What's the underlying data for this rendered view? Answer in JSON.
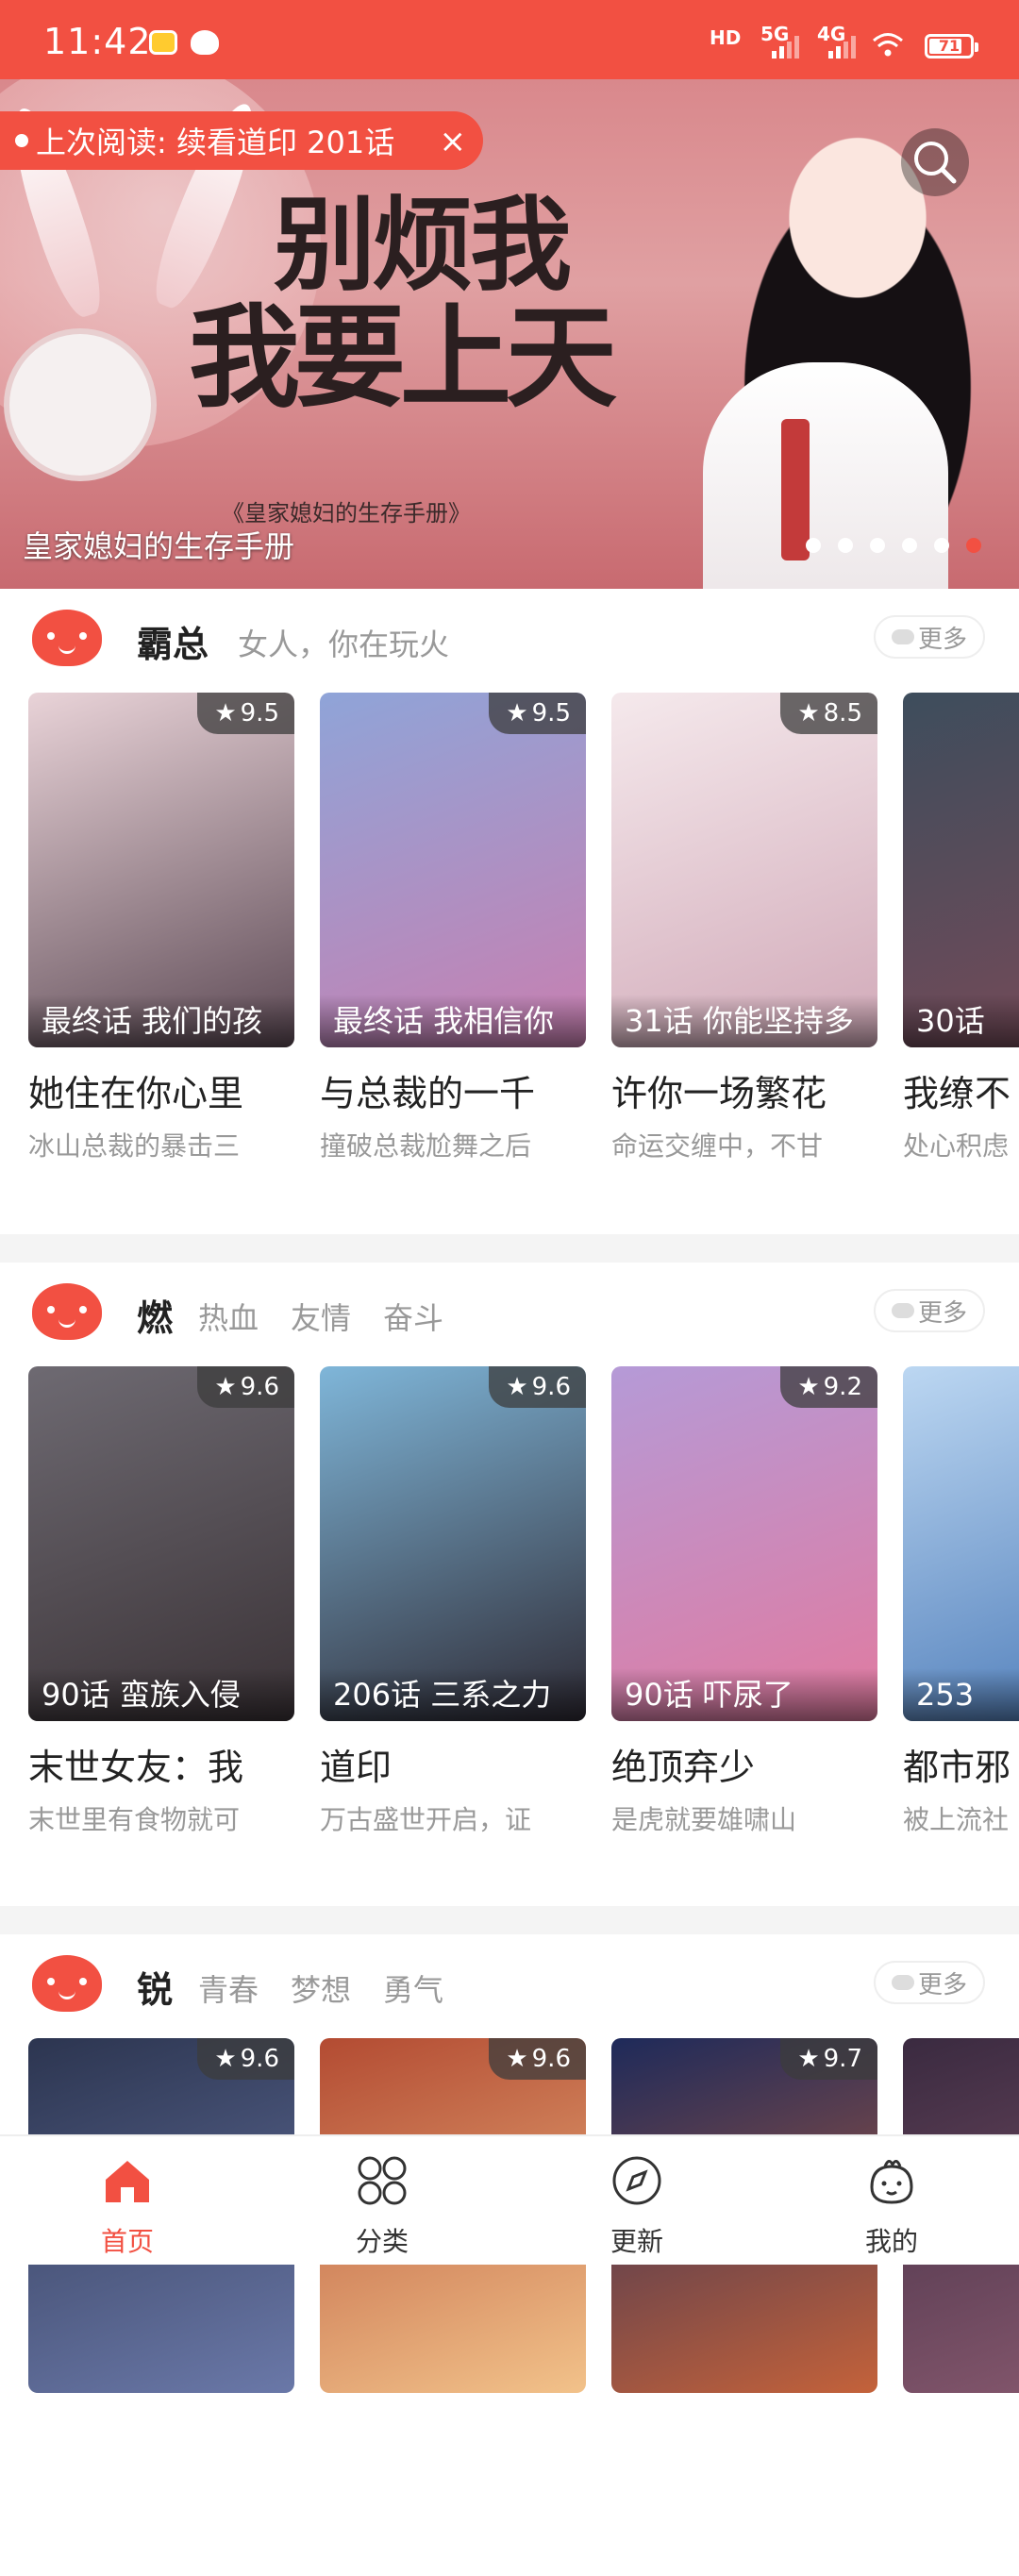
{
  "status_bar": {
    "time": "11:42",
    "network_labels": [
      "HD",
      "5G",
      "4G"
    ],
    "battery": "71"
  },
  "banner": {
    "last_read": "上次阅读: 续看道印 201话",
    "close": "×",
    "art_line1": "别烦我",
    "art_line2": "我要上天",
    "art_subtitle": "《皇家媳妇的生存手册》",
    "caption": "皇家媳妇的生存手册",
    "dot_count": 6,
    "active_dot": 5
  },
  "sections": [
    {
      "title": "霸总",
      "tags": [
        "女人，你在玩火"
      ],
      "more": "更多",
      "cards": [
        {
          "rating": "9.5",
          "episode": "最终话 我们的孩",
          "title": "她住在你心里",
          "desc": "冰山总裁的暴击三",
          "colors": [
            "#e9d3d8",
            "#5d4a55"
          ]
        },
        {
          "rating": "9.5",
          "episode": "最终话 我相信你",
          "title": "与总裁的一千",
          "desc": "撞破总裁尬舞之后",
          "colors": [
            "#8fa4d8",
            "#c87fb0"
          ]
        },
        {
          "rating": "8.5",
          "episode": "31话 你能坚持多",
          "title": "许你一场繁花",
          "desc": "命运交缠中，不甘",
          "colors": [
            "#f5e9ec",
            "#d1a9b8"
          ]
        },
        {
          "rating": "",
          "episode": "30话",
          "title": "我缭不",
          "desc": "处心积虑",
          "colors": [
            "#3d4d5c",
            "#7a4a58"
          ]
        }
      ]
    },
    {
      "title": "燃",
      "tags": [
        "热血",
        "友情",
        "奋斗"
      ],
      "more": "更多",
      "cards": [
        {
          "rating": "9.6",
          "episode": "90话 蛮族入侵",
          "title": "末世女友：我",
          "desc": "末世里有食物就可",
          "colors": [
            "#6e6a72",
            "#3a3236"
          ]
        },
        {
          "rating": "9.6",
          "episode": "206话 三系之力",
          "title": "道印",
          "desc": "万古盛世开启，证",
          "colors": [
            "#7fb6d9",
            "#2e2a34"
          ]
        },
        {
          "rating": "9.2",
          "episode": "90话 吓尿了",
          "title": "绝顶弃少",
          "desc": "是虎就要雄啸山",
          "colors": [
            "#b59ad7",
            "#e17a9f"
          ]
        },
        {
          "rating": "",
          "episode": "253",
          "title": "都市邪",
          "desc": "被上流社",
          "colors": [
            "#bcd7f2",
            "#4a79b7"
          ]
        }
      ]
    },
    {
      "title": "锐",
      "tags": [
        "青春",
        "梦想",
        "勇气"
      ],
      "more": "更多",
      "cards": [
        {
          "rating": "9.6",
          "episode": "",
          "title": "",
          "desc": "",
          "colors": [
            "#2c3550",
            "#6a78a8"
          ]
        },
        {
          "rating": "9.6",
          "episode": "",
          "title": "",
          "desc": "",
          "colors": [
            "#b34b32",
            "#f2c28a"
          ]
        },
        {
          "rating": "9.7",
          "episode": "",
          "title": "",
          "desc": "",
          "colors": [
            "#1e2a5a",
            "#c4623a"
          ]
        },
        {
          "rating": "",
          "episode": "",
          "title": "",
          "desc": "",
          "colors": [
            "#3a2a40",
            "#8a5a70"
          ]
        }
      ]
    }
  ],
  "tabs": [
    {
      "label": "首页",
      "icon": "home-icon",
      "active": true
    },
    {
      "label": "分类",
      "icon": "category-icon",
      "active": false
    },
    {
      "label": "更新",
      "icon": "compass-icon",
      "active": false
    },
    {
      "label": "我的",
      "icon": "profile-icon",
      "active": false
    }
  ],
  "colors": {
    "accent": "#f25042",
    "muted": "#999999",
    "divider": "#f4f4f4"
  }
}
